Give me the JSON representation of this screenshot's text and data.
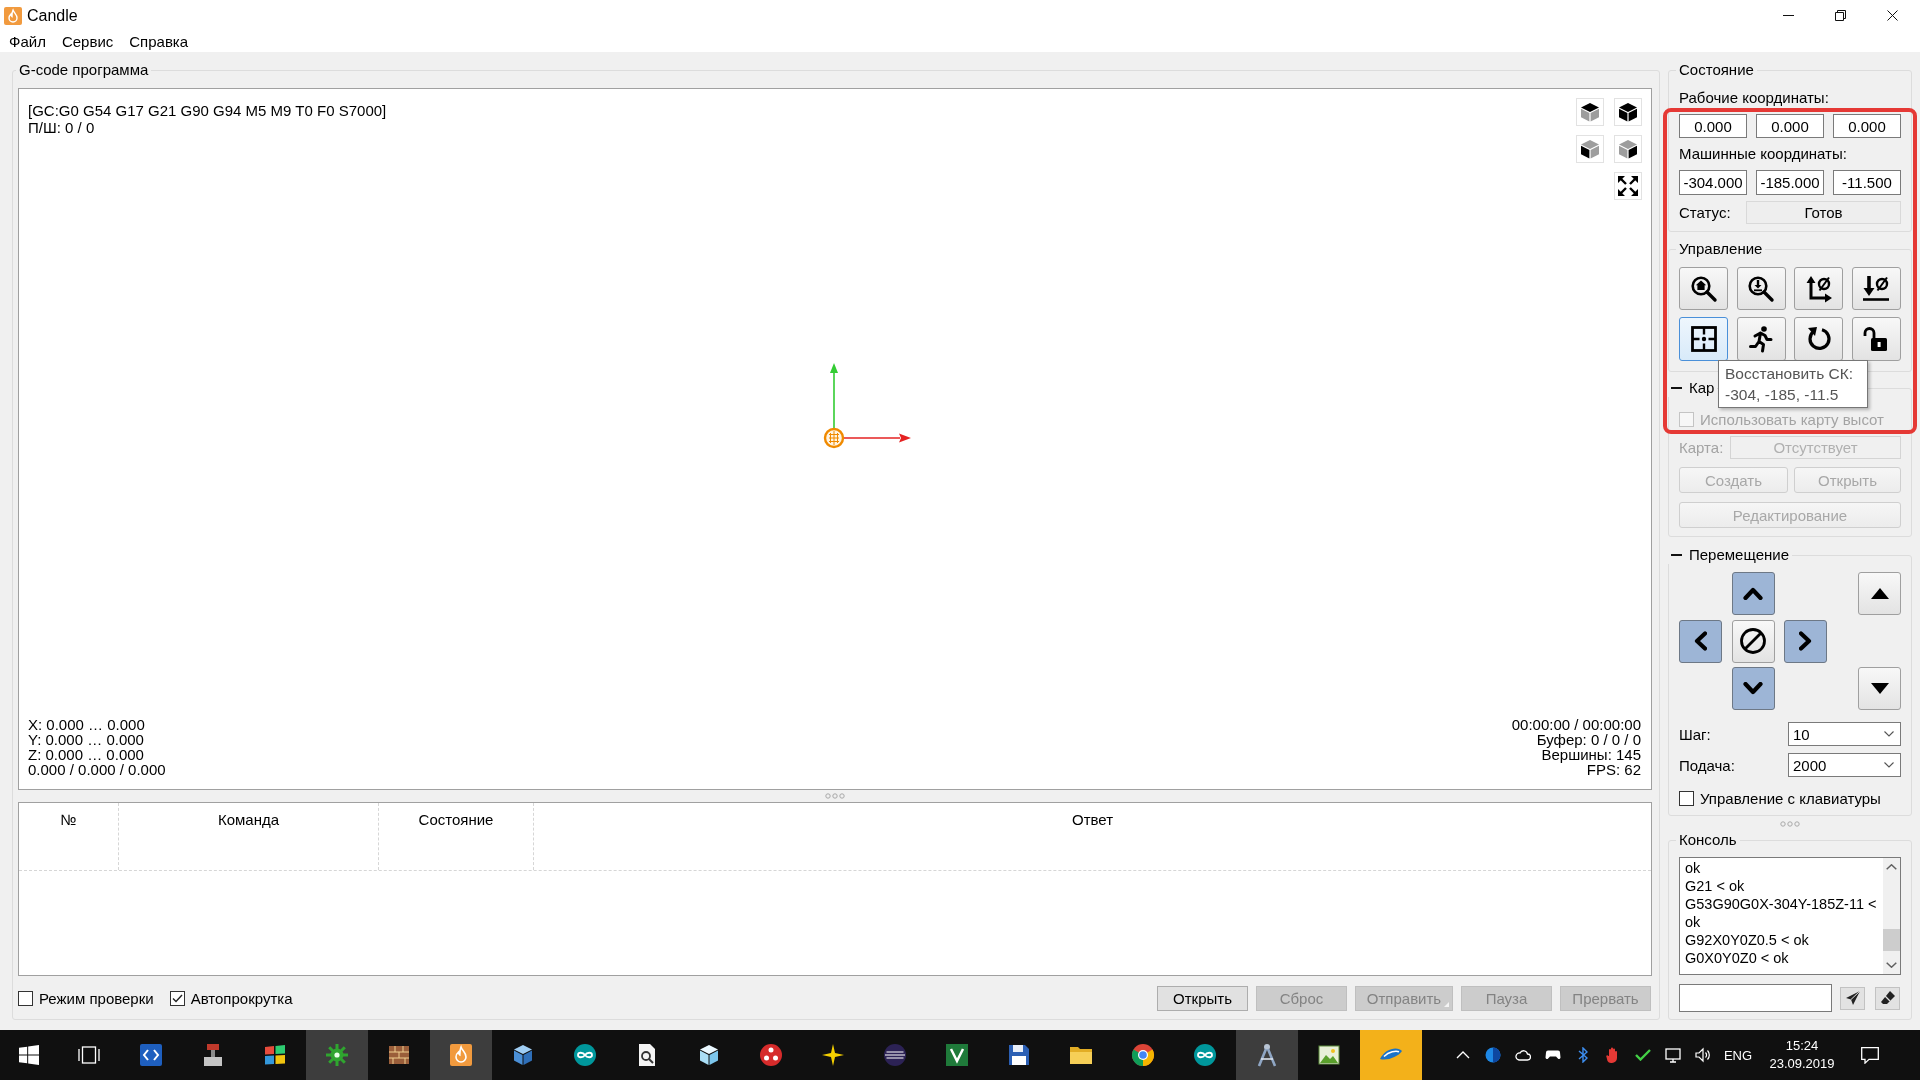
{
  "window": {
    "title": "Candle"
  },
  "menu": [
    {
      "label": "Файл"
    },
    {
      "label": "Сервис"
    },
    {
      "label": "Справка"
    }
  ],
  "gcode_panel": {
    "title": "G-code программа",
    "view": {
      "info_top": [
        "[GC:G0 G54 G17 G21 G90 G94 M5 M9 T0 F0 S7000]",
        "П/Ш: 0 / 0"
      ],
      "info_bottom_left": [
        "X: 0.000 … 0.000",
        "Y: 0.000 … 0.000",
        "Z: 0.000 … 0.000",
        "0.000 / 0.000 / 0.000"
      ],
      "info_bottom_right": [
        "00:00:00 / 00:00:00",
        "Буфер: 0 / 0 / 0",
        "Вершины: 145",
        "FPS: 62"
      ],
      "view_buttons": [
        {
          "kind": "top"
        },
        {
          "kind": "iso"
        },
        {
          "kind": "left"
        },
        {
          "kind": "right"
        },
        {
          "kind": "fit"
        }
      ]
    },
    "table": {
      "columns": [
        "№",
        "Команда",
        "Состояние",
        "Ответ"
      ]
    },
    "options": [
      {
        "label": "Режим проверки",
        "checked": false
      },
      {
        "label": "Автопрокрутка",
        "checked": true
      }
    ],
    "buttons": [
      {
        "label": "Открыть",
        "disabled": false,
        "has_menu": false
      },
      {
        "label": "Сброс",
        "disabled": true,
        "has_menu": false
      },
      {
        "label": "Отправить",
        "disabled": true,
        "has_menu": true
      },
      {
        "label": "Пауза",
        "disabled": true,
        "has_menu": false
      },
      {
        "label": "Прервать",
        "disabled": true,
        "has_menu": false
      }
    ]
  },
  "state_panel": {
    "title": "Состояние",
    "work_label": "Рабочие координаты:",
    "work_coordinates": [
      "0.000",
      "0.000",
      "0.000"
    ],
    "machine_label": "Машинные координаты:",
    "machine_coordinates": [
      "-304.000",
      "-185.000",
      "-11.500"
    ],
    "status_label": "Статус:",
    "status": "Готов"
  },
  "control_panel": {
    "title": "Управление",
    "buttons": [
      {
        "kind": "home",
        "hovered": false
      },
      {
        "kind": "probe",
        "hovered": false
      },
      {
        "kind": "zero-xy",
        "hovered": false
      },
      {
        "kind": "zero-z",
        "hovered": false
      },
      {
        "kind": "restore-origin",
        "hovered": true
      },
      {
        "kind": "safe-position",
        "hovered": false
      },
      {
        "kind": "reset",
        "hovered": false
      },
      {
        "kind": "unlock",
        "hovered": false
      }
    ],
    "tooltip": "Восстановить СК:\n-304, -185, -11.5"
  },
  "heightmap_panel": {
    "title": "Кар",
    "expanded": true,
    "use_heightmap": {
      "label": "Использовать карту высот",
      "checked": false,
      "disabled": true
    },
    "map": {
      "label": "Карта:",
      "value": "Отсутствует",
      "disabled": true
    },
    "buttons": [
      {
        "label": "Создать",
        "disabled": true
      },
      {
        "label": "Открыть",
        "disabled": true
      },
      {
        "label": "Редактирование",
        "disabled": true
      }
    ]
  },
  "jog_panel": {
    "title": "Перемещение",
    "expanded": true,
    "buttons": [
      {
        "kind": "y-plus",
        "accent": true
      },
      {
        "kind": "z-plus",
        "accent": false
      },
      {
        "kind": "x-minus",
        "accent": true
      },
      {
        "kind": "stop",
        "accent": false
      },
      {
        "kind": "x-plus",
        "accent": true
      },
      {
        "kind": "y-minus",
        "accent": true
      },
      {
        "kind": "z-minus",
        "accent": false
      }
    ],
    "step_label": "Шаг:",
    "step": "10",
    "feed_label": "Подача:",
    "feed": "2000",
    "keyboard_control": {
      "label": "Управление с клавиатуры",
      "checked": false
    }
  },
  "console_panel": {
    "title": "Консоль",
    "lines": [
      "ok",
      "G21 < ok",
      "G53G90G0X-304Y-185Z-11 <",
      "ok",
      "G92X0Y0Z0.5 < ok",
      "G0X0Y0Z0 < ok"
    ]
  },
  "taskbar": {
    "apps": [
      {
        "kind": "code-tile",
        "active": false,
        "flashing": false
      },
      {
        "kind": "press",
        "active": false,
        "flashing": false
      },
      {
        "kind": "tiles",
        "active": false,
        "flashing": false
      },
      {
        "kind": "gear",
        "active": true,
        "flashing": false
      },
      {
        "kind": "bricks",
        "active": false,
        "flashing": false
      },
      {
        "kind": "flame",
        "active": true,
        "flashing": false
      },
      {
        "kind": "cube",
        "active": false,
        "flashing": false
      },
      {
        "kind": "infinity",
        "active": false,
        "flashing": false
      },
      {
        "kind": "doc-search",
        "active": false,
        "flashing": false
      },
      {
        "kind": "ice",
        "active": false,
        "flashing": false
      },
      {
        "kind": "red-disc",
        "active": false,
        "flashing": false
      },
      {
        "kind": "sparkle",
        "active": false,
        "flashing": false
      },
      {
        "kind": "eclipse",
        "active": false,
        "flashing": false
      },
      {
        "kind": "v-tile",
        "active": false,
        "flashing": false
      },
      {
        "kind": "floppy",
        "active": false,
        "flashing": false
      },
      {
        "kind": "folder",
        "active": false,
        "flashing": false
      },
      {
        "kind": "chrome",
        "active": false,
        "flashing": false
      },
      {
        "kind": "infinity",
        "active": false,
        "flashing": false
      },
      {
        "kind": "compass",
        "active": true,
        "flashing": false
      },
      {
        "kind": "picture",
        "active": false,
        "flashing": false
      },
      {
        "kind": "swoosh",
        "active": false,
        "flashing": true
      }
    ],
    "language": "ENG",
    "time": "15:24",
    "date": "23.09.2019"
  }
}
